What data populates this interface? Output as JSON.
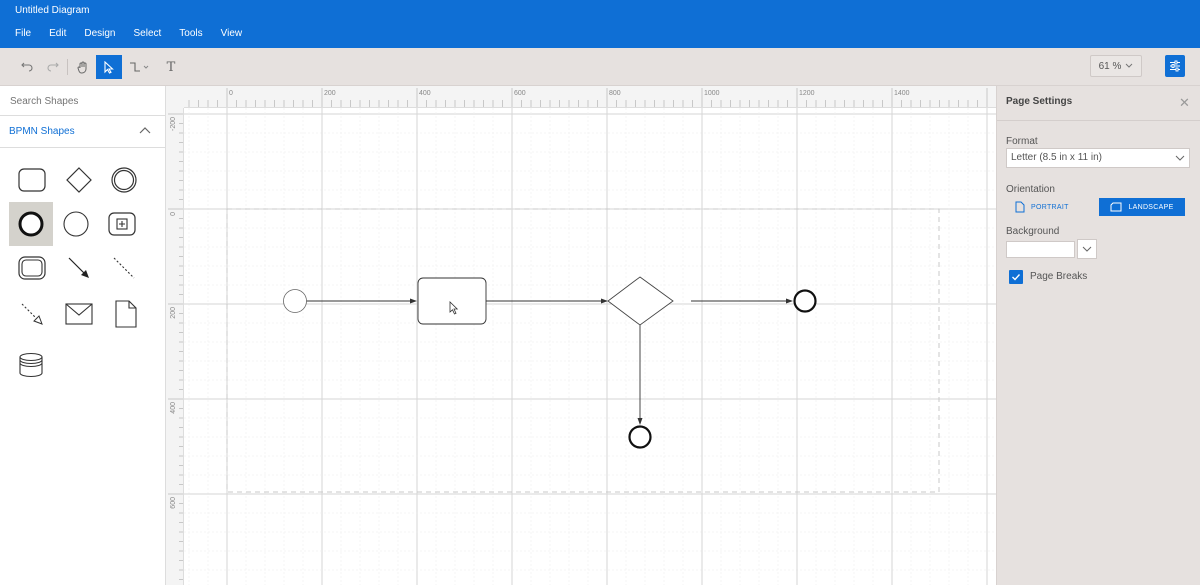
{
  "app": {
    "title": "Untitled Diagram"
  },
  "menu": [
    "File",
    "Edit",
    "Design",
    "Select",
    "Tools",
    "View"
  ],
  "toolbar": {
    "undo_icon": "undo-icon",
    "redo_icon": "redo-icon",
    "pan_icon": "hand-icon",
    "select_icon": "pointer-icon",
    "connector_icon": "connector-icon",
    "text_icon": "T",
    "zoom": "61 %",
    "settings_icon": "settings-sliders-icon"
  },
  "shapes_panel": {
    "search_placeholder": "Search Shapes",
    "category": "BPMN Shapes",
    "shapes": [
      "task",
      "gateway",
      "intermediate-event",
      "end-event",
      "start-event",
      "subprocess",
      "transaction",
      "sequence-flow",
      "association",
      "message-flow",
      "message",
      "data-object",
      "data-store"
    ]
  },
  "rulers": {
    "horizontal": [
      "0",
      "200",
      "400",
      "600",
      "800",
      "1000",
      "1200",
      "1400"
    ],
    "vertical": [
      "-200",
      "0",
      "200",
      "400",
      "600"
    ]
  },
  "page_settings": {
    "title": "Page Settings",
    "format_label": "Format",
    "format_value": "Letter (8.5 in x 11 in)",
    "orientation_label": "Orientation",
    "portrait_label": "PORTRAIT",
    "landscape_label": "LANDSCAPE",
    "selected_orientation": "LANDSCAPE",
    "background_label": "Background",
    "background_color": "#ffffff",
    "page_breaks_label": "Page Breaks",
    "page_breaks_checked": true
  },
  "colors": {
    "accent": "#0f6fd5",
    "panel_bg": "#e6e1df"
  }
}
